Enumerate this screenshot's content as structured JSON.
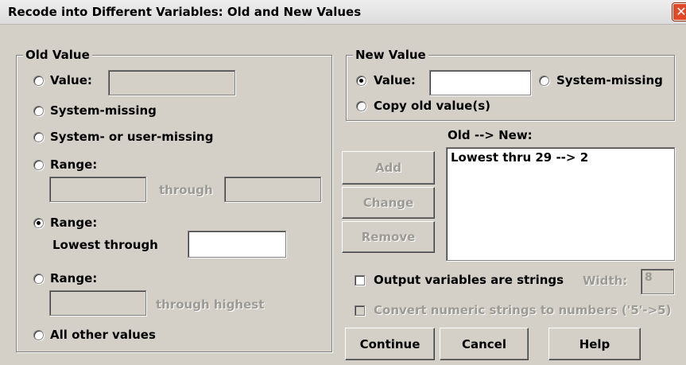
{
  "window": {
    "title": "Recode into Different Variables: Old and New Values",
    "close_glyph": "✕"
  },
  "old_value": {
    "legend": "Old Value",
    "value_label": "Value:",
    "value_input": "",
    "system_missing_label": "System-missing",
    "system_or_user_missing_label": "System- or user-missing",
    "range_label": "Range:",
    "range_from": "",
    "range_through_label": "through",
    "range_to": "",
    "range_lowest_label": "Range:",
    "lowest_through_label": "Lowest through",
    "lowest_through_input": "",
    "range_highest_label": "Range:",
    "highest_from": "",
    "through_highest_label": "through highest",
    "all_other_label": "All other values",
    "selected": "range_lowest"
  },
  "new_value": {
    "legend": "New Value",
    "value_label": "Value:",
    "value_input": "",
    "system_missing_label": "System-missing",
    "copy_old_label": "Copy old value(s)",
    "selected": "value"
  },
  "mappings": {
    "heading": "Old --> New:",
    "items": [
      "Lowest thru 29 --> 2"
    ]
  },
  "buttons": {
    "add": "Add",
    "change": "Change",
    "remove": "Remove",
    "continue": "Continue",
    "cancel": "Cancel",
    "help": "Help"
  },
  "options": {
    "output_strings_label": "Output variables are strings",
    "width_label": "Width:",
    "width_value": "8",
    "convert_label": "Convert numeric strings to numbers ('5'->5)"
  }
}
